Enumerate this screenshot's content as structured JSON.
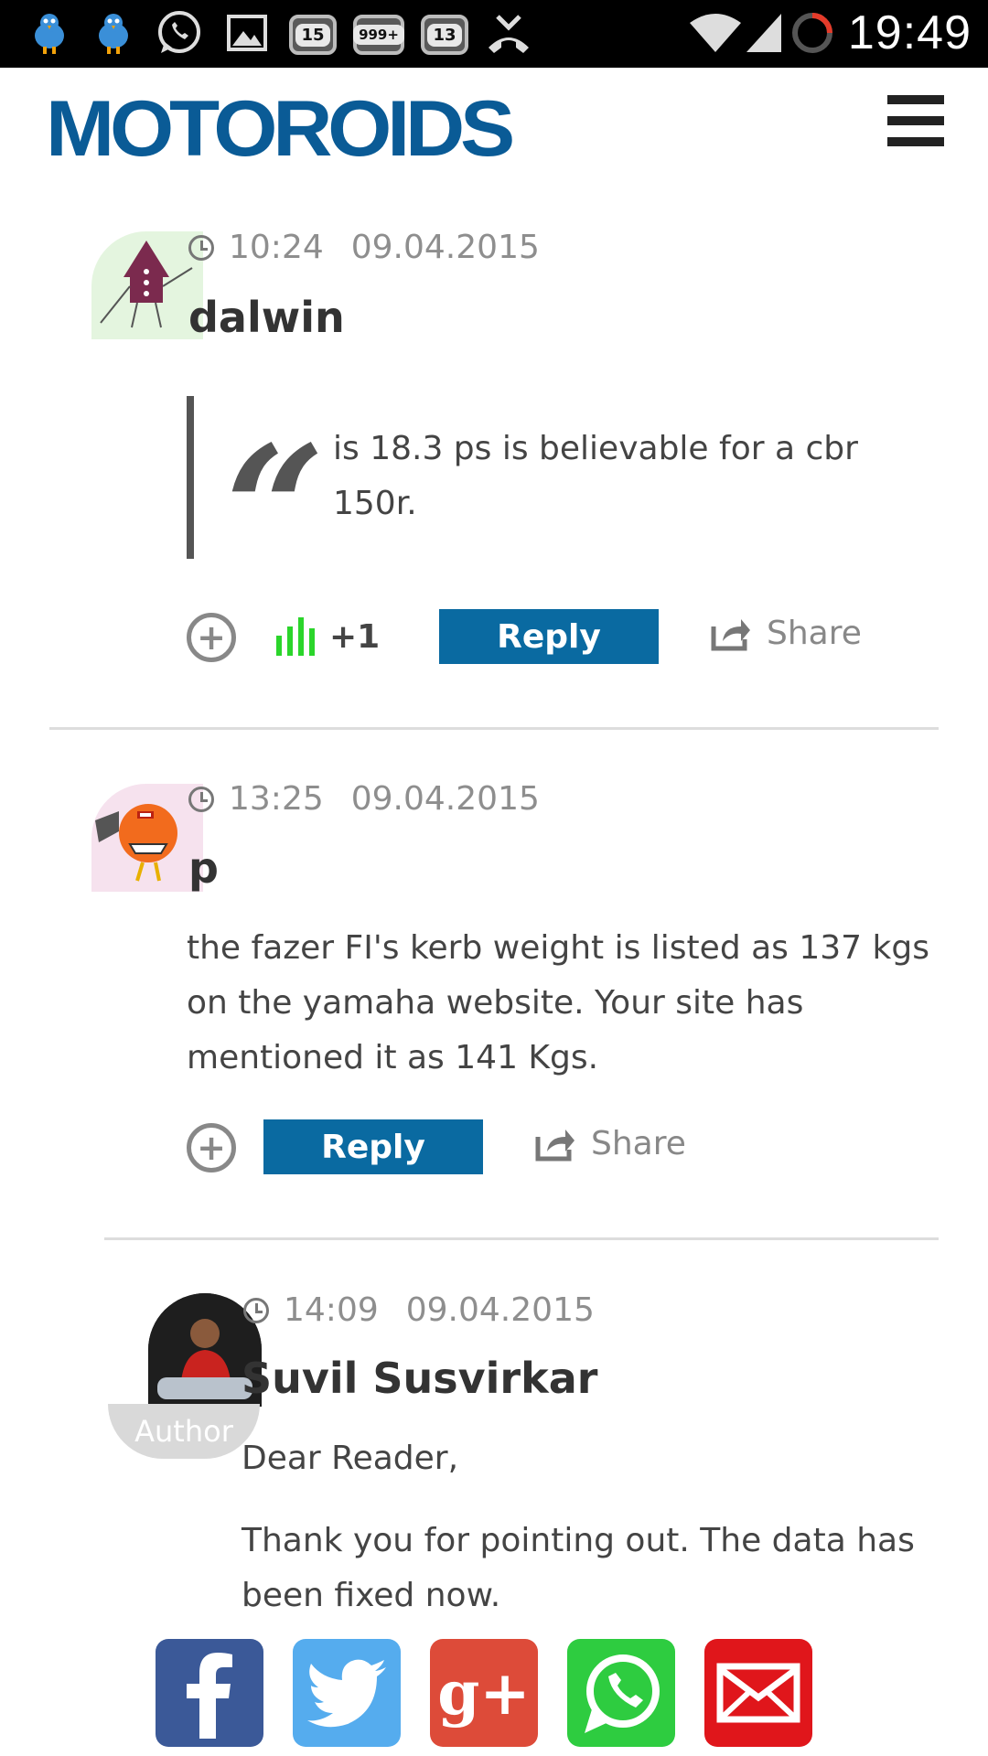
{
  "status_bar": {
    "badges": [
      "15",
      "999+",
      "13"
    ],
    "time": "19:49"
  },
  "header": {
    "logo_text": "MOTOROIDS",
    "menu_icon": "hamburger-icon"
  },
  "comments": [
    {
      "time": "10:24",
      "date": "09.04.2015",
      "author": "dalwin",
      "quote": "is 18.3 ps is believable for a cbr 150r.",
      "votes": "+1",
      "reply_label": "Reply",
      "share_label": "Share"
    },
    {
      "time": "13:25",
      "date": "09.04.2015",
      "author": "p",
      "text": "the fazer FI's kerb weight is listed as 137 kgs on the yamaha website. Your site has mentioned it as 141 Kgs.",
      "reply_label": "Reply",
      "share_label": "Share"
    },
    {
      "time": "14:09",
      "date": "09.04.2015",
      "author": "Suvil Susvirkar",
      "author_tag": "Author",
      "paragraphs": [
        "Dear Reader,",
        "Thank you for pointing out. The data has been fixed now."
      ]
    }
  ],
  "share_bar": {
    "buttons": [
      {
        "name": "facebook",
        "color": "#3b5998",
        "glyph": "f"
      },
      {
        "name": "twitter",
        "color": "#55acee",
        "glyph": ""
      },
      {
        "name": "google-plus",
        "color": "#dd4b39",
        "glyph": "g+"
      },
      {
        "name": "whatsapp",
        "color": "#2ecc40",
        "glyph": ""
      },
      {
        "name": "email",
        "color": "#e0161b",
        "glyph": ""
      }
    ]
  }
}
